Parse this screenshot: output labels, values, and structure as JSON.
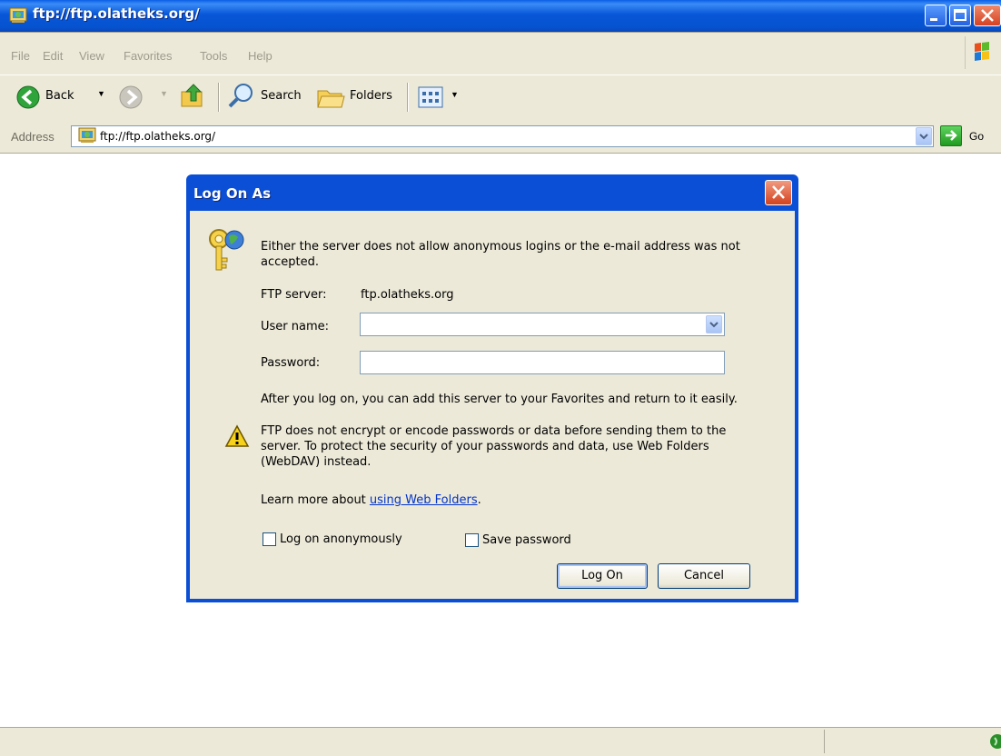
{
  "window": {
    "title": "ftp://ftp.olatheks.org/"
  },
  "menu": {
    "items": [
      "File",
      "Edit",
      "View",
      "Favorites",
      "Tools",
      "Help"
    ]
  },
  "toolbar": {
    "back_label": "Back",
    "search_label": "Search",
    "folders_label": "Folders"
  },
  "address": {
    "label": "Address",
    "value": "ftp://ftp.olatheks.org/",
    "go_label": "Go"
  },
  "dialog": {
    "title": "Log On As",
    "message": "Either the server does not allow anonymous logins or the e-mail address was not accepted.",
    "ftp_server_label": "FTP server:",
    "ftp_server_value": "ftp.olatheks.org",
    "username_label": "User name:",
    "username_value": "",
    "password_label": "Password:",
    "password_value": "",
    "favorites_note": "After you log on, you can add this server to your Favorites and return to it easily.",
    "warning_text": "FTP does not encrypt or encode passwords or data before sending them to the server.  To protect the security of your passwords and data, use Web Folders (WebDAV) instead.",
    "learn_more_prefix": "Learn more about ",
    "learn_more_link": "using Web Folders",
    "learn_more_suffix": ".",
    "anonymous_label": "Log on anonymously",
    "anonymous_checked": false,
    "save_password_label": "Save password",
    "save_password_checked": false,
    "logon_button": "Log On",
    "cancel_button": "Cancel"
  },
  "colors": {
    "titlebar_blue": "#0857d8",
    "dialog_face": "#ece9d8",
    "link": "#0033cc",
    "close_red": "#d44122"
  }
}
